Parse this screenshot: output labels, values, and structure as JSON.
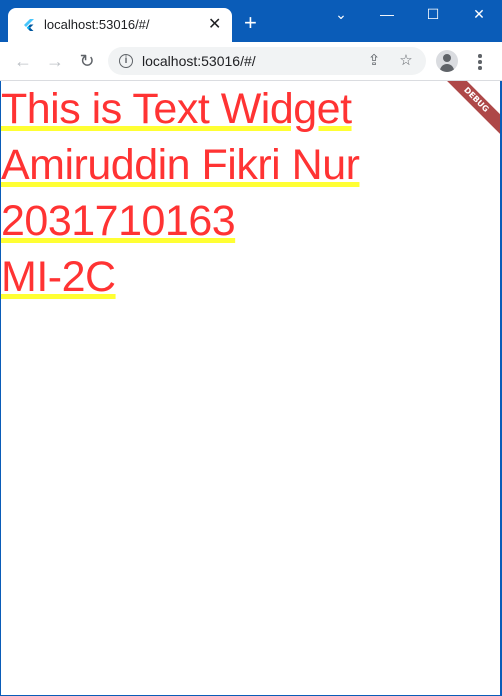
{
  "browser": {
    "tab_title": "localhost:53016/#/",
    "new_tab_icon": "+",
    "address": "localhost:53016/#/",
    "accent_color": "#0a5cb8"
  },
  "app": {
    "lines": [
      "This is Text Widget",
      "Amiruddin Fikri Nur",
      "2031710163",
      "MI-2C"
    ],
    "text_color": "#ff3333",
    "underline_color": "#ffff33",
    "debug_banner": "DEBUG"
  }
}
